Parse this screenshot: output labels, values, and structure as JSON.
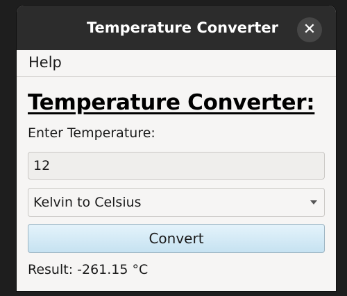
{
  "window": {
    "title": "Temperature Converter",
    "close_symbol": "✕"
  },
  "menu": {
    "items": [
      {
        "label": "Help"
      }
    ]
  },
  "main": {
    "heading": "Temperature Converter:",
    "prompt": "Enter Temperature:",
    "temperature_value": "12",
    "conversion": {
      "selected": "Kelvin to Celsius"
    },
    "convert_label": "Convert",
    "result": "Result: -261.15 °C"
  },
  "icons": {
    "close": "close-icon",
    "dropdown": "chevron-down-icon"
  },
  "colors": {
    "titlebar": "#2c2c2c",
    "window_bg": "#f6f5f4",
    "button_gradient_top": "#e4f3fb",
    "button_gradient_bottom": "#c6e2f1"
  }
}
